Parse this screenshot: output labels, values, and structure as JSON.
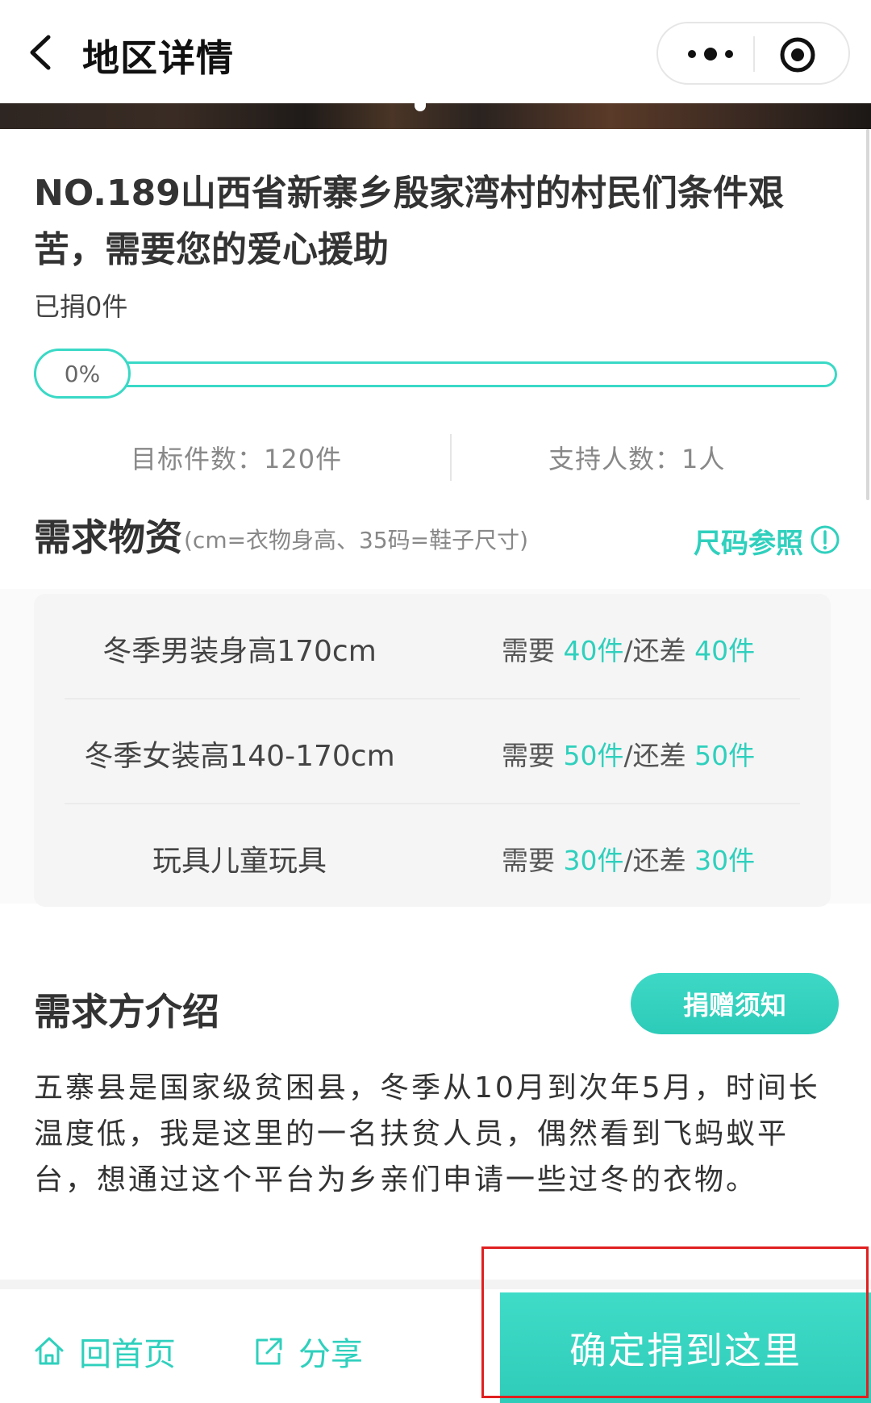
{
  "header": {
    "title": "地区详情",
    "back_icon": "chevron-left-icon",
    "more_icon": "more-dots-icon",
    "close_icon": "target-icon"
  },
  "project": {
    "title": "NO.189山西省新寨乡殷家湾村的村民们条件艰苦，需要您的爱心援助",
    "donated": "已捐0件",
    "progress_label": "0%",
    "progress_value": 0,
    "target": "目标件数：120件",
    "supporters": "支持人数：1人"
  },
  "needs": {
    "title": "需求物资",
    "note": "(cm=衣物身高、35码=鞋子尺寸)",
    "size_ref": "尺码参照",
    "items": [
      {
        "name": "冬季男装身高170cm",
        "need_prefix": "需要 ",
        "need": "40件",
        "sep": "/还差 ",
        "remain": "40件"
      },
      {
        "name": "冬季女装高140-170cm",
        "need_prefix": "需要 ",
        "need": "50件",
        "sep": "/还差 ",
        "remain": "50件"
      },
      {
        "name": "玩具儿童玩具",
        "need_prefix": "需要 ",
        "need": "30件",
        "sep": "/还差 ",
        "remain": "30件"
      }
    ]
  },
  "intro": {
    "title": "需求方介绍",
    "notice_button": "捐赠须知",
    "text": " 五寨县是国家级贫困县，冬季从10月到次年5月，时间长温度低，我是这里的一名扶贫人员，偶然看到飞蚂蚁平台，想通过这个平台为乡亲们申请一些过冬的衣物。"
  },
  "bottom_bar": {
    "home_label": "回首页",
    "share_label": "分享",
    "confirm_label": "确定捐到这里"
  },
  "colors": {
    "accent": "#2fd0bd",
    "highlight": "#e02020"
  }
}
